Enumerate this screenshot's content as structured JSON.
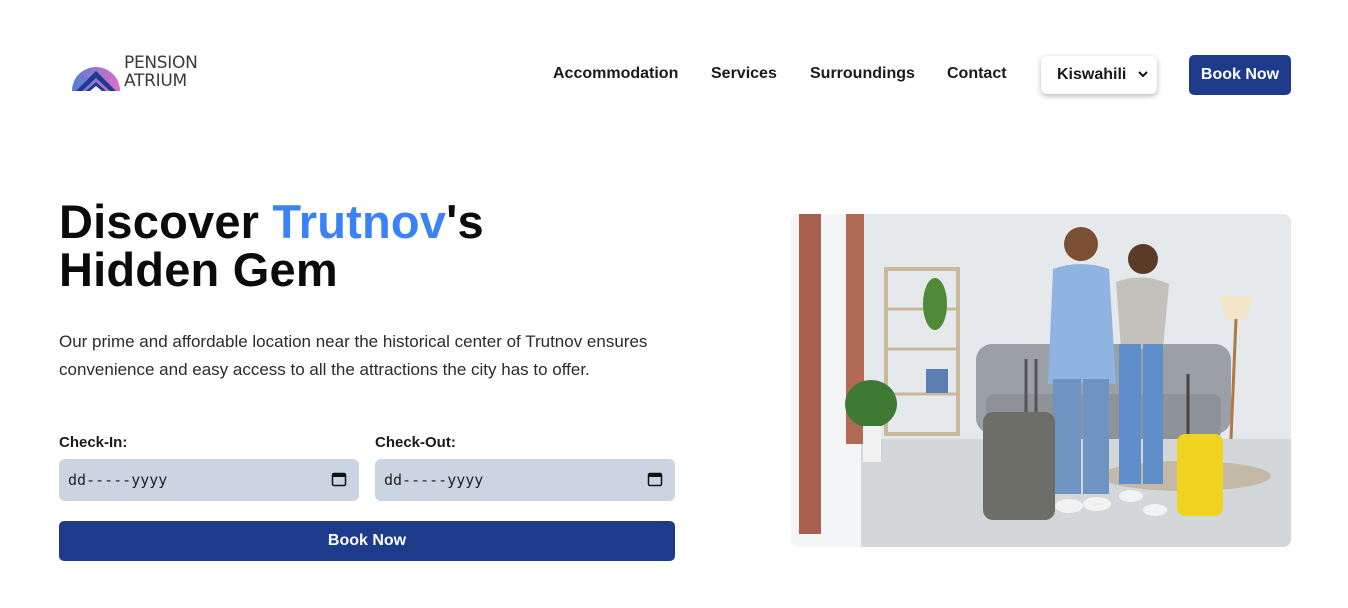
{
  "brand": {
    "line1": "PENSION",
    "line2": "ATRIUM"
  },
  "nav": {
    "items": [
      {
        "label": "Accommodation"
      },
      {
        "label": "Services"
      },
      {
        "label": "Surroundings"
      },
      {
        "label": "Contact"
      }
    ],
    "language": "Kiswahili",
    "book_label": "Book Now"
  },
  "hero": {
    "title_part1": "Discover ",
    "title_accent": "Trutnov",
    "title_part2": "'s",
    "title_line2": "Hidden Gem",
    "description": "Our prime and affordable location near the historical center of Trutnov ensures convenience and easy access to all the attractions the city has to offer."
  },
  "booking": {
    "checkin_label": "Check-In:",
    "checkin_placeholder": "dd-----yyyy",
    "checkout_label": "Check-Out:",
    "checkout_placeholder": "dd-----yyyy",
    "submit_label": "Book Now"
  },
  "icons": {
    "select": "chevron-down-icon",
    "date": "calendar-icon",
    "logo": "mountain-logo-icon"
  },
  "colors": {
    "primary": "#1e3a8a",
    "accent": "#3b82f6",
    "input_bg": "#cbd5e1"
  }
}
